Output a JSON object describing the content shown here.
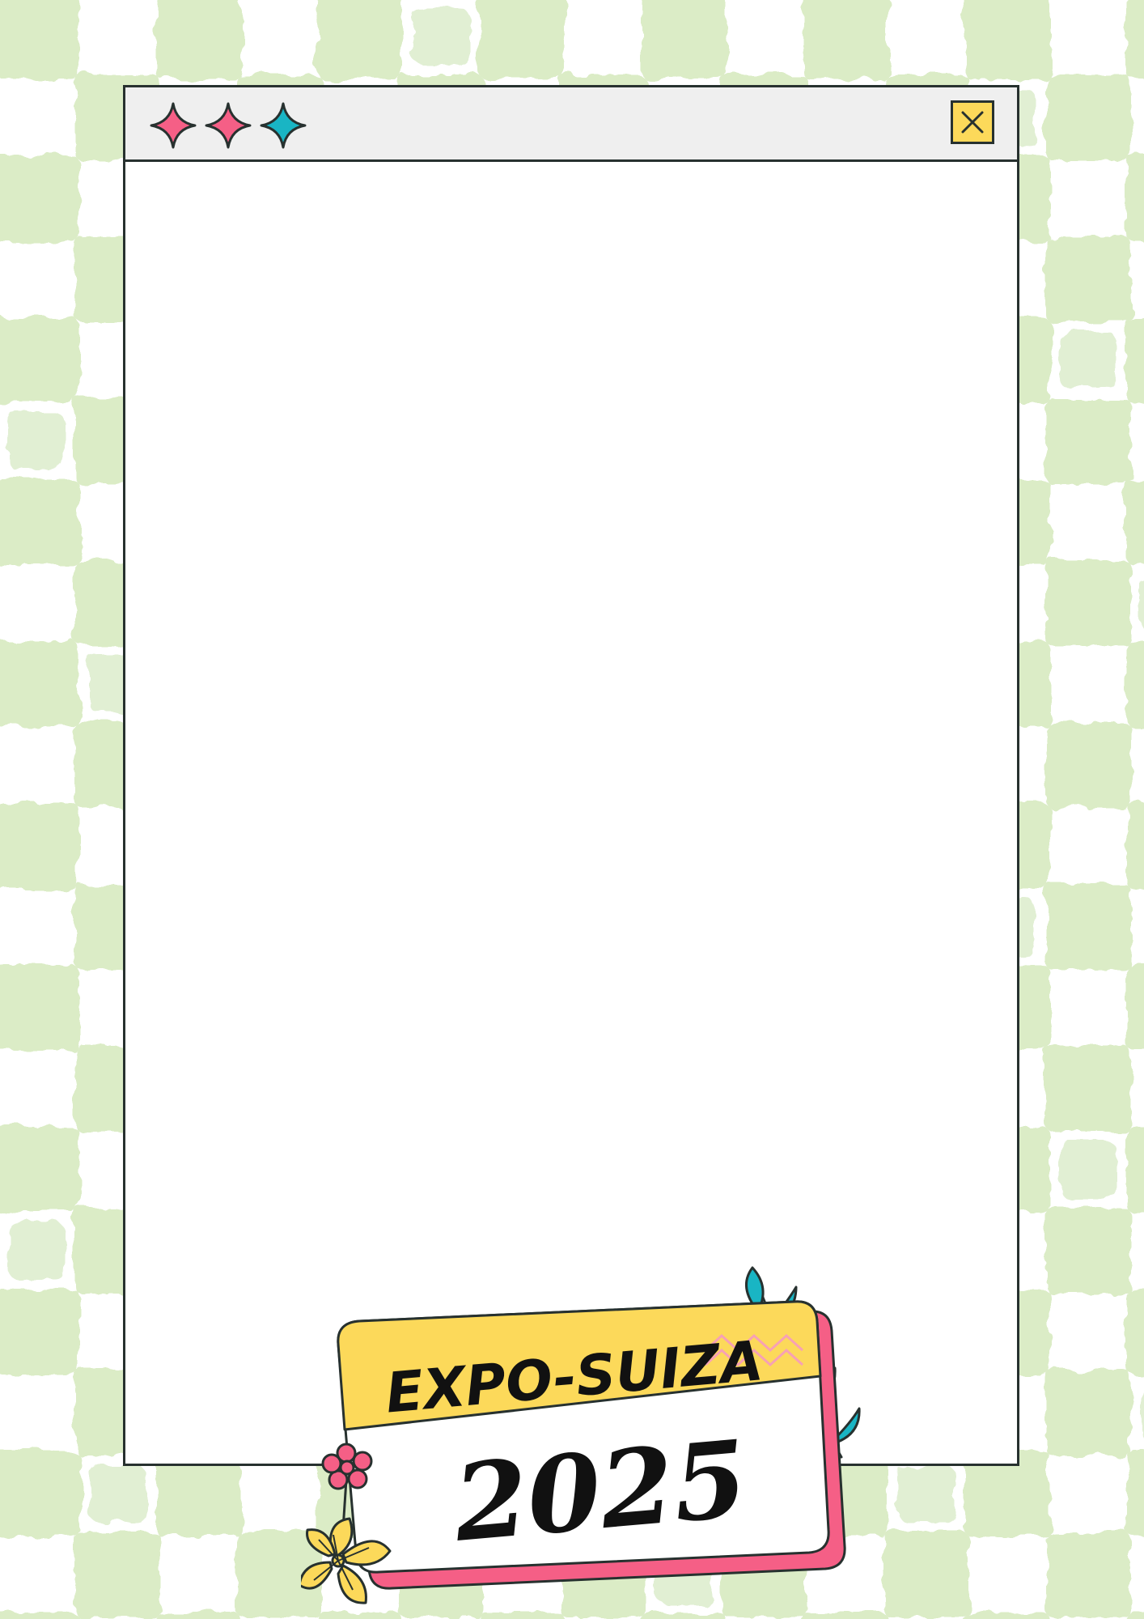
{
  "window": {
    "title_stars": [
      "sparkle-star-pink",
      "sparkle-star-pink",
      "sparkle-star-teal"
    ],
    "close_icon": "close-x-icon"
  },
  "badge": {
    "title": "EXPO-SUIZA",
    "year": "2025"
  },
  "colors": {
    "background_green": "#cfe6b4",
    "frame_dark": "#27312f",
    "titlebar_gray": "#efefef",
    "pink": "#f55f86",
    "teal": "#19b5c4",
    "yellow": "#fcd95a"
  }
}
